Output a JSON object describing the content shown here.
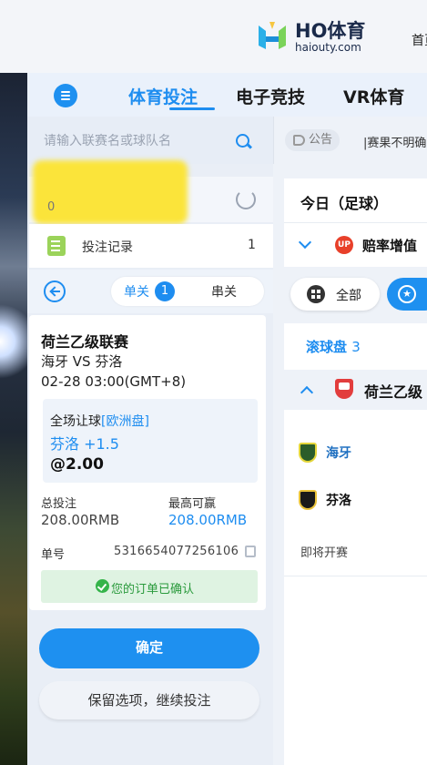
{
  "header": {
    "logo_main": "HO体育",
    "logo_sub": "haiouty.com",
    "right_link": "首页"
  },
  "tabs": [
    {
      "label": "体育投注",
      "active": true
    },
    {
      "label": "电子竞技",
      "active": false
    },
    {
      "label": "VR体育",
      "active": false
    }
  ],
  "search": {
    "placeholder": "请输入联赛名或球队名"
  },
  "account": {
    "balance_first_digit": "0"
  },
  "bet_record": {
    "label": "投注记录",
    "count": "1"
  },
  "betslip": {
    "single_label": "单关",
    "single_count": "1",
    "parlay_label": "串关",
    "league": "荷兰乙级联赛",
    "teams": "海牙 VS 芬洛",
    "time": "02-28 03:00(GMT+8)",
    "market": "全场让球",
    "market_type": "[欧洲盘]",
    "pick": "芬洛 +1.5",
    "odds": "@2.00",
    "stake_label": "总投注",
    "stake_value": "208.00RMB",
    "max_win_label": "最高可赢",
    "max_win_value": "208.00RMB",
    "order_label": "单号",
    "order_number": "5316654077256106",
    "confirm_message": "您的订单已确认",
    "ok_button": "确定",
    "keep_button": "保留选项，继续投注"
  },
  "right": {
    "notice_label": "公告",
    "notice_text": "|赛果不明确",
    "today_title": "今日（足球）",
    "up_badge": "UP",
    "up_title": "赔率增值",
    "all_label": "全部",
    "live_label": "滚球盘",
    "live_count": "3",
    "league_name": "荷兰乙级",
    "home_team": "海牙",
    "away_team": "芬洛",
    "status": "即将开赛"
  },
  "colors": {
    "accent": "#1e8df0",
    "success": "#35b44a",
    "up_red": "#e8402a"
  }
}
